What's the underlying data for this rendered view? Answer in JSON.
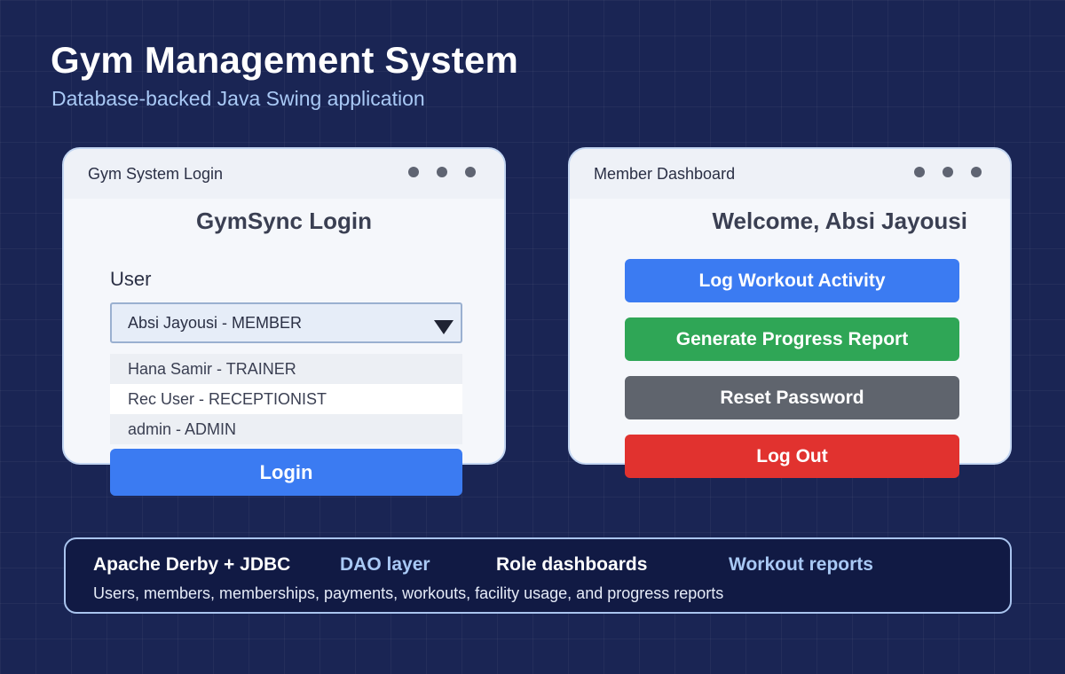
{
  "hero": {
    "title": "Gym Management System",
    "subtitle": "Database-backed Java Swing application"
  },
  "login_window": {
    "title": "Gym System Login",
    "heading": "GymSync Login",
    "user_label": "User",
    "selected_user": "Absi Jayousi - MEMBER",
    "options": [
      {
        "name": "Hana Samir",
        "role": "TRAINER"
      },
      {
        "name": "Rec User",
        "role": "RECEPTIONIST"
      },
      {
        "name": "admin",
        "role": "ADMIN"
      }
    ],
    "option_labels": [
      "Hana Samir - TRAINER",
      "Rec User - RECEPTIONIST",
      "admin - ADMIN"
    ],
    "login_button": "Login"
  },
  "dashboard_window": {
    "title": "Member Dashboard",
    "welcome": "Welcome, Absi Jayousi",
    "buttons": {
      "log_workout": "Log Workout Activity",
      "progress_report": "Generate Progress Report",
      "reset_password": "Reset Password",
      "log_out": "Log Out"
    }
  },
  "info_panel": {
    "tags": [
      "Apache Derby + JDBC",
      "DAO layer",
      "Role dashboards",
      "Workout reports"
    ],
    "description": "Users, members, memberships, payments, workouts, facility usage, and progress reports"
  },
  "colors": {
    "background": "#1a2554",
    "accent_blue": "#3b7bf2",
    "success_green": "#2fa656",
    "neutral_gray": "#5f646d",
    "danger_red": "#e1322f",
    "light_blue_text": "#a9c9f5"
  }
}
